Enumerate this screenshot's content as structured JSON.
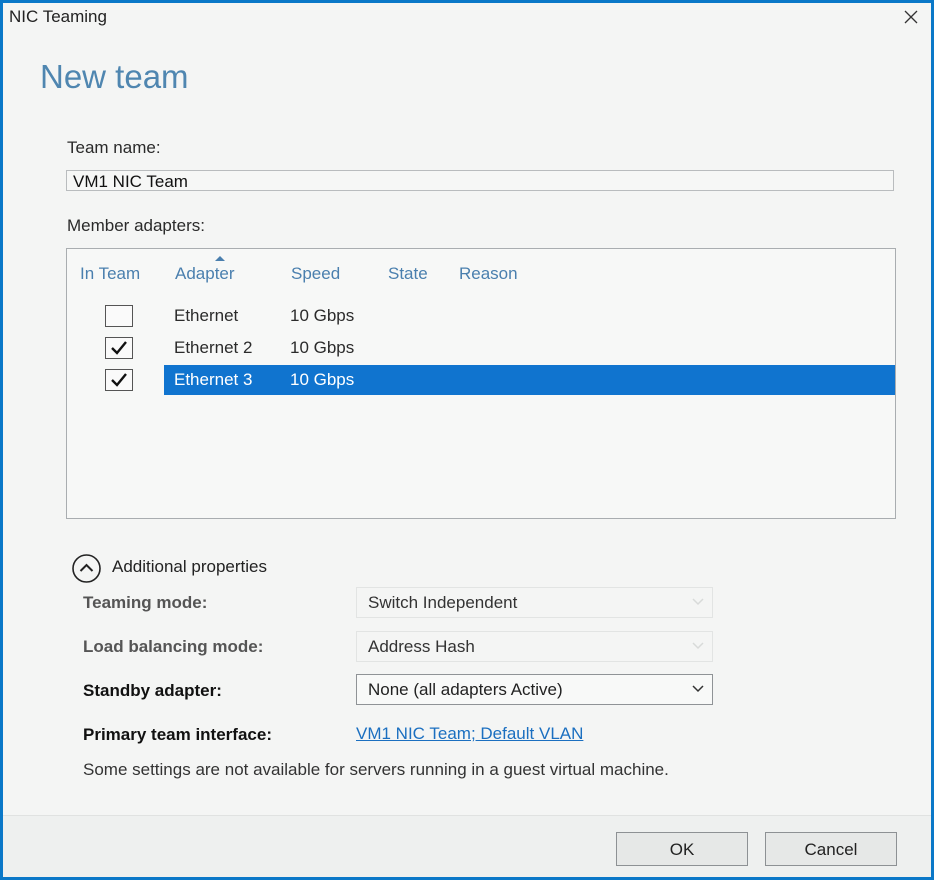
{
  "window": {
    "title": "NIC Teaming"
  },
  "heading": "New team",
  "team_name": {
    "label": "Team name:",
    "value": "VM1 NIC Team"
  },
  "members": {
    "label": "Member adapters:",
    "columns": [
      "In Team",
      "Adapter",
      "Speed",
      "State",
      "Reason"
    ],
    "rows": [
      {
        "checked": false,
        "adapter": "Ethernet",
        "speed": "10 Gbps",
        "selected": false
      },
      {
        "checked": true,
        "adapter": "Ethernet 2",
        "speed": "10 Gbps",
        "selected": false
      },
      {
        "checked": true,
        "adapter": "Ethernet 3",
        "speed": "10 Gbps",
        "selected": true
      }
    ]
  },
  "additional": {
    "label": "Additional properties",
    "teaming_mode": {
      "label": "Teaming mode:",
      "value": "Switch Independent"
    },
    "load_balancing": {
      "label": "Load balancing mode:",
      "value": "Address Hash"
    },
    "standby": {
      "label": "Standby adapter:",
      "value": "None (all adapters Active)"
    },
    "primary_interface": {
      "label": "Primary team interface:",
      "value": "VM1 NIC Team; Default VLAN"
    },
    "note": "Some settings are not available for servers running in a guest virtual machine."
  },
  "buttons": {
    "ok": "OK",
    "cancel": "Cancel"
  },
  "colors": {
    "accent": "#1074cf",
    "heading": "#4f86b0",
    "link": "#1b6fc0",
    "frame": "#0a78c8"
  }
}
